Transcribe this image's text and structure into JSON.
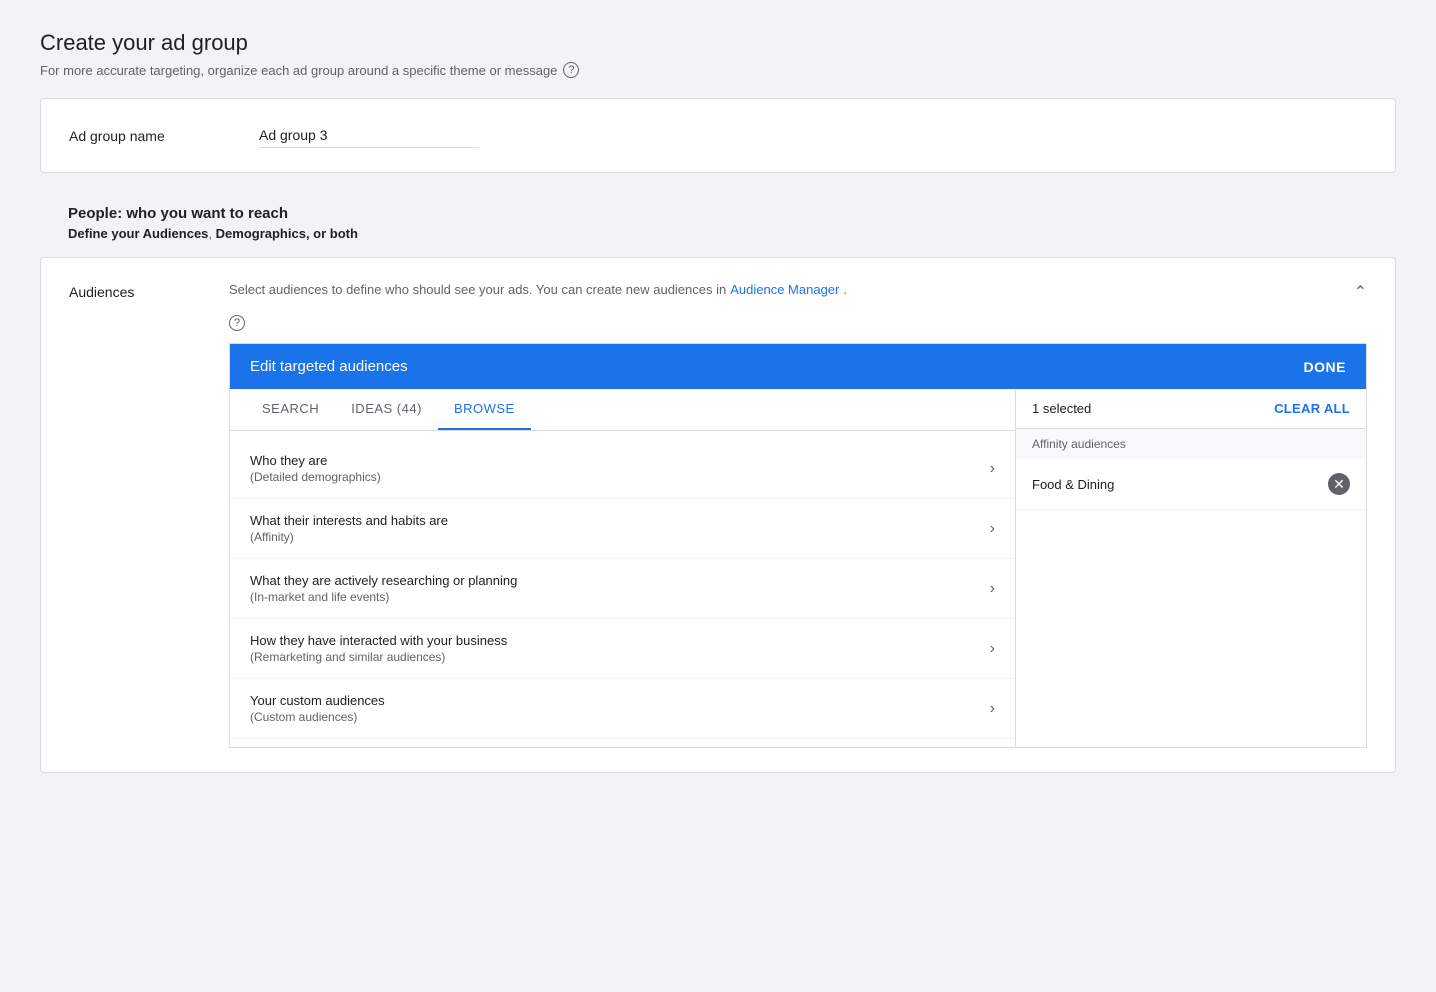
{
  "page": {
    "title": "Create your ad group",
    "subtitle": "For more accurate targeting, organize each ad group around a specific theme or message",
    "help_icon_label": "?"
  },
  "ad_group_name": {
    "label": "Ad group name",
    "value": "Ad group 3",
    "placeholder": "Ad group 3"
  },
  "people_section": {
    "title_prefix": "People",
    "title_suffix": ": who you want to reach",
    "desc_prefix": "Define your ",
    "audiences_link": "Audiences",
    "demographics_link": "Demographics",
    "desc_suffix": ", or both"
  },
  "audiences": {
    "label": "Audiences",
    "description_prefix": "Select audiences to define who should see your ads.  You can create new audiences in ",
    "audience_manager_link": "Audience Manager",
    "description_suffix": ".",
    "help_icon": "?",
    "edit_panel": {
      "title": "Edit targeted audiences",
      "done_label": "DONE",
      "tabs": [
        {
          "label": "SEARCH",
          "id": "search"
        },
        {
          "label": "IDEAS (44)",
          "id": "ideas"
        },
        {
          "label": "BROWSE",
          "id": "browse",
          "active": true
        }
      ],
      "browse_items": [
        {
          "main": "Who they are",
          "sub": "(Detailed demographics)"
        },
        {
          "main": "What their interests and habits are",
          "sub": "(Affinity)"
        },
        {
          "main": "What they are actively researching or planning",
          "sub": "(In-market and life events)"
        },
        {
          "main": "How they have interacted with your business",
          "sub": "(Remarketing and similar audiences)"
        },
        {
          "main": "Your custom audiences",
          "sub": "(Custom audiences)"
        }
      ],
      "right_panel": {
        "selected_count": "1 selected",
        "clear_all_label": "CLEAR ALL",
        "affinity_header": "Affinity audiences",
        "selected_items": [
          {
            "name": "Food & Dining"
          }
        ]
      }
    }
  }
}
